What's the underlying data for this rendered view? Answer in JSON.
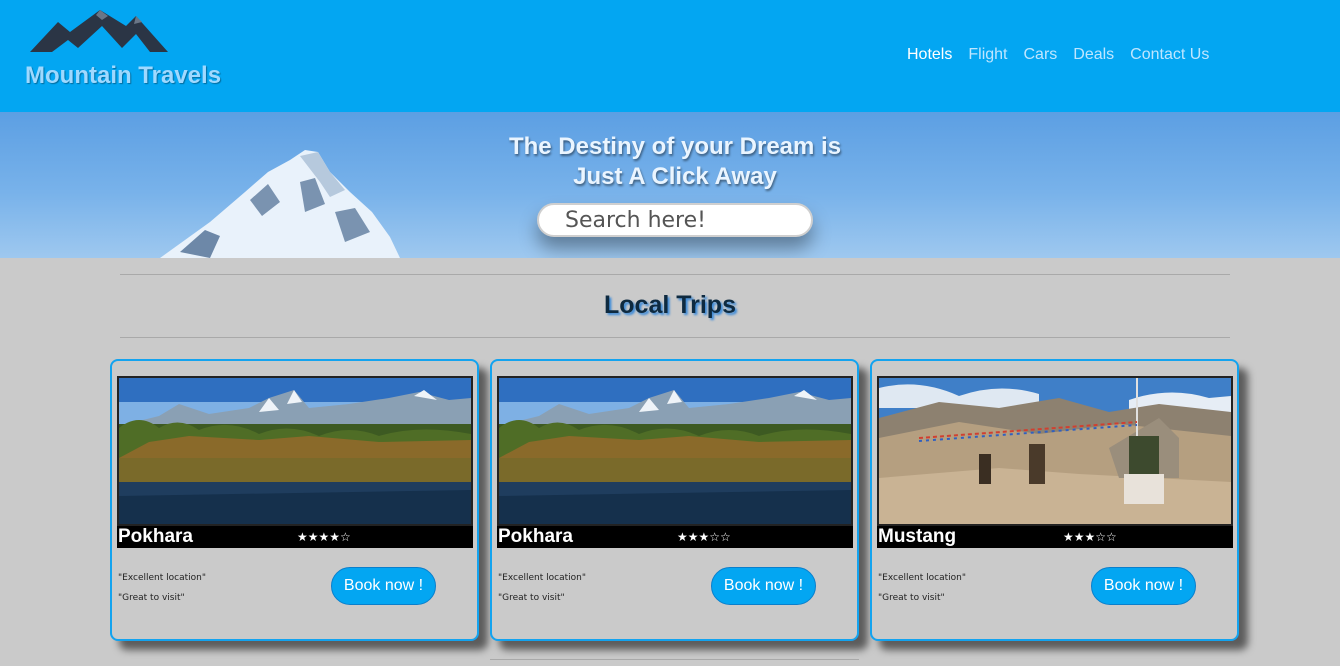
{
  "header": {
    "brand": "Mountain Travels",
    "nav": [
      "Hotels",
      "Flight",
      "Cars",
      "Deals",
      "Contact Us"
    ],
    "active_nav": "Hotels"
  },
  "hero": {
    "title_line1": "The Destiny of your Dream is",
    "title_line2": "Just A Click Away",
    "search_placeholder": "Search here!"
  },
  "section": {
    "title": "Local Trips"
  },
  "cards": [
    {
      "place": "Pokhara",
      "stars": "★★★★☆",
      "rating": 4,
      "review1": "\"Excellent location\"",
      "review2": "\"Great to visit\"",
      "button": "Book now !"
    },
    {
      "place": "Pokhara",
      "stars": "★★★☆☆",
      "rating": 3,
      "review1": "\"Excellent location\"",
      "review2": "\"Great to visit\"",
      "button": "Book now !"
    },
    {
      "place": "Mustang",
      "stars": "★★★☆☆",
      "rating": 3,
      "review1": "\"Excellent location\"",
      "review2": "\"Great to visit\"",
      "button": "Book now !"
    }
  ],
  "colors": {
    "header_bg": "#03a6f2",
    "page_bg": "#cacaca",
    "accent": "#13a3ef"
  }
}
